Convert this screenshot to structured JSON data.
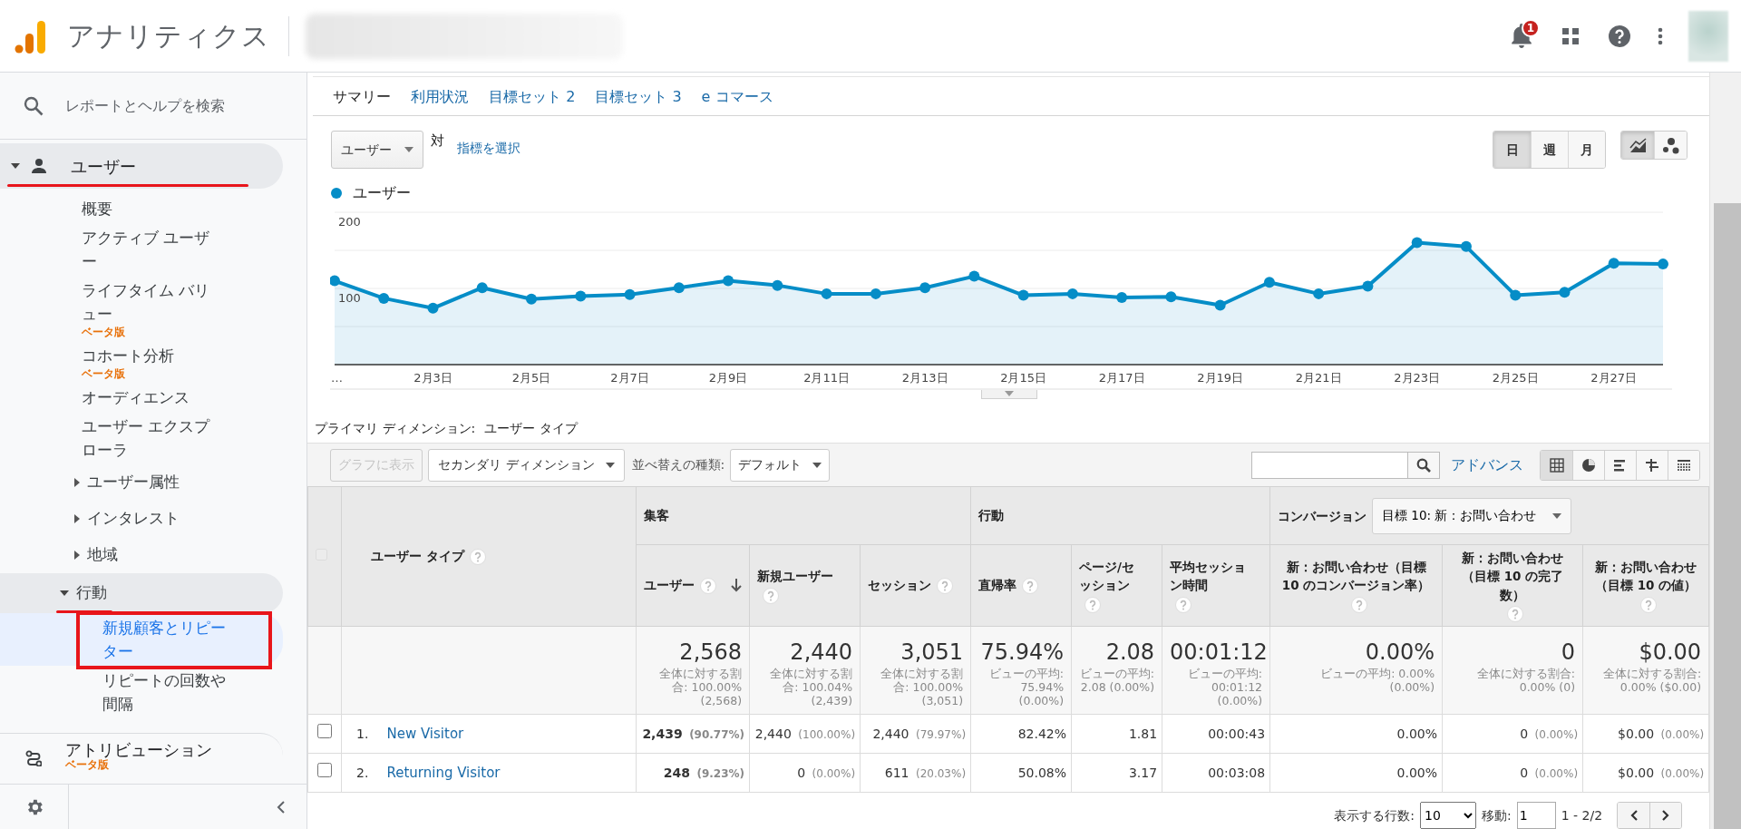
{
  "header": {
    "product": "アナリティクス",
    "notifications": "1"
  },
  "sidebar": {
    "search_placeholder": "レポートとヘルプを検索",
    "sections": [
      {
        "label": "ユーザー",
        "expanded": true,
        "highlighted": true,
        "children": [
          {
            "label": "概要",
            "selected": false
          },
          {
            "label": "アクティブ ユーザー",
            "selected": false
          },
          {
            "label": "ライフタイム バリュー",
            "badge": "ベータ版",
            "selected": false
          },
          {
            "label": "コホート分析",
            "badge": "ベータ版",
            "selected": false
          },
          {
            "label": "オーディエンス",
            "selected": false
          },
          {
            "label": "ユーザー エクスプローラ",
            "selected": false
          },
          {
            "label": "ユーザー属性",
            "expanded": false
          },
          {
            "label": "インタレスト",
            "expanded": false
          },
          {
            "label": "地域",
            "expanded": false
          },
          {
            "label": "行動",
            "expanded": true,
            "highlighted": true,
            "children": [
              {
                "label": "新規顧客とリピーター",
                "selected": true,
                "highlighted": true
              },
              {
                "label": "リピートの回数や間隔",
                "selected": false
              }
            ]
          }
        ]
      },
      {
        "label": "アトリビューション",
        "badge": "ベータ版",
        "expanded": false
      }
    ]
  },
  "report_tabs": [
    {
      "label": "サマリー",
      "selected": true
    },
    {
      "label": "利用状況",
      "selected": false
    },
    {
      "label": "目標セット 2",
      "selected": false
    },
    {
      "label": "目標セット 3",
      "selected": false
    },
    {
      "label": "e コマース",
      "selected": false
    }
  ],
  "chart_controls": {
    "metric": "ユーザー",
    "vs_label": "対",
    "select_metric": "指標を選択",
    "granularity": [
      {
        "label": "日",
        "selected": true
      },
      {
        "label": "週",
        "selected": false
      },
      {
        "label": "月",
        "selected": false
      }
    ],
    "chart_types": [
      {
        "kind": "line",
        "selected": true
      },
      {
        "kind": "motion",
        "selected": false
      }
    ]
  },
  "chart": {
    "chart_data": {
      "type": "area",
      "categories": [
        "…",
        null,
        "2月3日",
        null,
        "2月5日",
        null,
        "2月7日",
        null,
        "2月9日",
        null,
        "2月11日",
        null,
        "2月13日",
        null,
        "2月15日",
        null,
        "2月17日",
        null,
        "2月19日",
        null,
        "2月21日",
        null,
        "2月23日",
        null,
        "2月25日",
        null,
        "2月27日",
        null
      ],
      "series": [
        {
          "name": "ユーザー",
          "color": "#058dc7",
          "values": [
            110,
            87,
            74,
            101,
            86,
            90,
            92,
            101,
            110,
            104,
            93,
            93,
            101,
            116,
            91,
            93,
            88,
            89,
            78,
            108,
            93,
            103,
            160,
            155,
            91,
            95,
            133,
            132
          ]
        }
      ],
      "ylim": [
        0,
        200
      ],
      "yticks": [
        100,
        200
      ]
    }
  },
  "table_toolbar": {
    "primary_label": "プライマリ ディメンション:",
    "primary_value": "ユーザー タイプ",
    "plot_button": {
      "label": "グラフに表示",
      "disabled": true
    },
    "secondary_dimension": "セカンダリ ディメンション",
    "sort_label": "並べ替えの種類:",
    "sort_value": "デフォルト",
    "advanced": "アドバンス",
    "views": [
      {
        "kind": "table",
        "selected": true
      },
      {
        "kind": "pie",
        "selected": false
      },
      {
        "kind": "performance",
        "selected": false
      },
      {
        "kind": "comparison",
        "selected": false
      },
      {
        "kind": "pivot",
        "selected": false
      }
    ]
  },
  "table": {
    "select_all": {
      "checked": false,
      "disabled": true
    },
    "dimension": "ユーザー タイプ",
    "groups": [
      {
        "label": "集客",
        "columns": [
          {
            "label": "ユーザー",
            "sorted": true
          },
          {
            "label": "新規ユーザー",
            "sorted": false
          },
          {
            "label": "セッション",
            "sorted": false
          }
        ]
      },
      {
        "label": "行動",
        "columns": [
          {
            "label": "直帰率",
            "sorted": false
          },
          {
            "label": "ページ/セッション",
            "sorted": false
          },
          {
            "label": "平均セッション時間",
            "sorted": false
          }
        ]
      },
      {
        "label": "コンバージョン",
        "goal_select": "目標 10: 新：お問い合わせ",
        "columns": [
          {
            "label": "新：お問い合わせ（目標 10 のコンバージョン率）",
            "sorted": false
          },
          {
            "label": "新：お問い合わせ（目標 10 の完了数）",
            "sorted": false
          },
          {
            "label": "新：お問い合わせ（目標 10 の値）",
            "sorted": false
          }
        ]
      }
    ],
    "totals": [
      {
        "value": "2,568",
        "note": "全体に対する割合: 100.00% (2,568)"
      },
      {
        "value": "2,440",
        "note": "全体に対する割合: 100.04% (2,439)"
      },
      {
        "value": "3,051",
        "note": "全体に対する割合: 100.00% (3,051)"
      },
      {
        "value": "75.94%",
        "note": "ビューの平均: 75.94% (0.00%)"
      },
      {
        "value": "2.08",
        "note": "ビューの平均: 2.08 (0.00%)"
      },
      {
        "value": "00:01:12",
        "note": "ビューの平均: 00:01:12 (0.00%)"
      },
      {
        "value": "0.00%",
        "note": "ビューの平均: 0.00% (0.00%)"
      },
      {
        "value": "0",
        "note": "全体に対する割合: 0.00% (0)"
      },
      {
        "value": "$0.00",
        "note": "全体に対する割合: 0.00% ($0.00)"
      }
    ],
    "rows": [
      {
        "index": "1.",
        "name": "New Visitor",
        "checked": false,
        "cells": [
          {
            "value": "2,439",
            "pct": "(90.77%)"
          },
          {
            "value": "2,440",
            "pct": "(100.00%)"
          },
          {
            "value": "2,440",
            "pct": "(79.97%)"
          },
          {
            "value": "82.42%"
          },
          {
            "value": "1.81"
          },
          {
            "value": "00:00:43"
          },
          {
            "value": "0.00%"
          },
          {
            "value": "0",
            "pct": "(0.00%)"
          },
          {
            "value": "$0.00",
            "pct": "(0.00%)"
          }
        ]
      },
      {
        "index": "2.",
        "name": "Returning Visitor",
        "checked": false,
        "cells": [
          {
            "value": "248",
            "pct": "(9.23%)"
          },
          {
            "value": "0",
            "pct": "(0.00%)"
          },
          {
            "value": "611",
            "pct": "(20.03%)"
          },
          {
            "value": "50.08%"
          },
          {
            "value": "3.17"
          },
          {
            "value": "00:03:08"
          },
          {
            "value": "0.00%"
          },
          {
            "value": "0",
            "pct": "(0.00%)"
          },
          {
            "value": "$0.00",
            "pct": "(0.00%)"
          }
        ]
      }
    ]
  },
  "pager": {
    "rows_label": "表示する行数:",
    "rows_value": "10",
    "goto_label": "移動:",
    "goto_value": "1",
    "range": "1 - 2/2"
  }
}
